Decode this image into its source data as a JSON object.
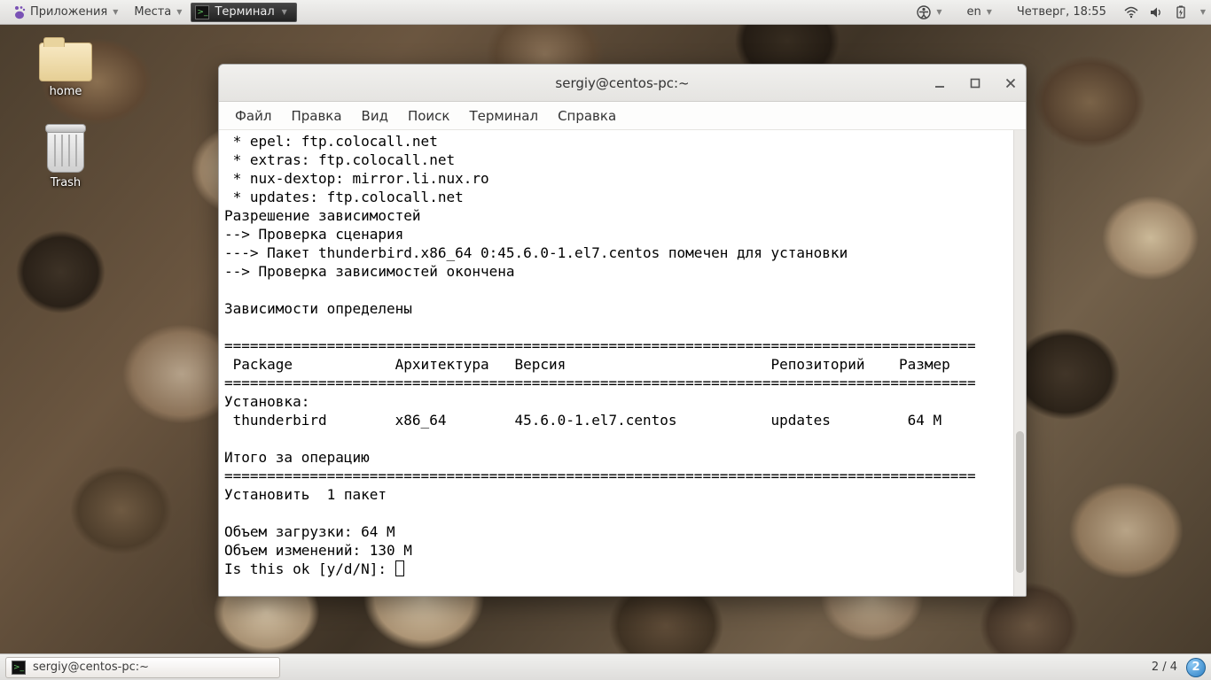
{
  "top_panel": {
    "applications": "Приложения",
    "places": "Места",
    "task_terminal": "Терминал",
    "lang": "en",
    "datetime": "Четверг, 18:55"
  },
  "desktop": {
    "home": "home",
    "trash": "Trash"
  },
  "window": {
    "title": "sergiy@centos-pc:~"
  },
  "menubar": {
    "file": "Файл",
    "edit": "Правка",
    "view": "Вид",
    "search": "Поиск",
    "terminal": "Терминал",
    "help": "Справка"
  },
  "terminal": {
    "l1": " * epel: ftp.colocall.net",
    "l2": " * extras: ftp.colocall.net",
    "l3": " * nux-dextop: mirror.li.nux.ro",
    "l4": " * updates: ftp.colocall.net",
    "l5": "Разрешение зависимостей",
    "l6": "--> Проверка сценария",
    "l7": "---> Пакет thunderbird.x86_64 0:45.6.0-1.el7.centos помечен для установки",
    "l8": "--> Проверка зависимостей окончена",
    "l9": "",
    "l10": "Зависимости определены",
    "l11": "",
    "l12": "========================================================================================",
    "l13": " Package            Архитектура   Версия                        Репозиторий    Размер",
    "l14": "========================================================================================",
    "l15": "Установка:",
    "l16": " thunderbird        x86_64        45.6.0-1.el7.centos           updates         64 M",
    "l17": "",
    "l18": "Итого за операцию",
    "l19": "========================================================================================",
    "l20": "Установить  1 пакет",
    "l21": "",
    "l22": "Объем загрузки: 64 M",
    "l23": "Объем изменений: 130 M",
    "l24": "Is this ok [y/d/N]: "
  },
  "bottom_panel": {
    "task": "sergiy@centos-pc:~",
    "workspace": "2 / 4",
    "notif_count": "2"
  }
}
